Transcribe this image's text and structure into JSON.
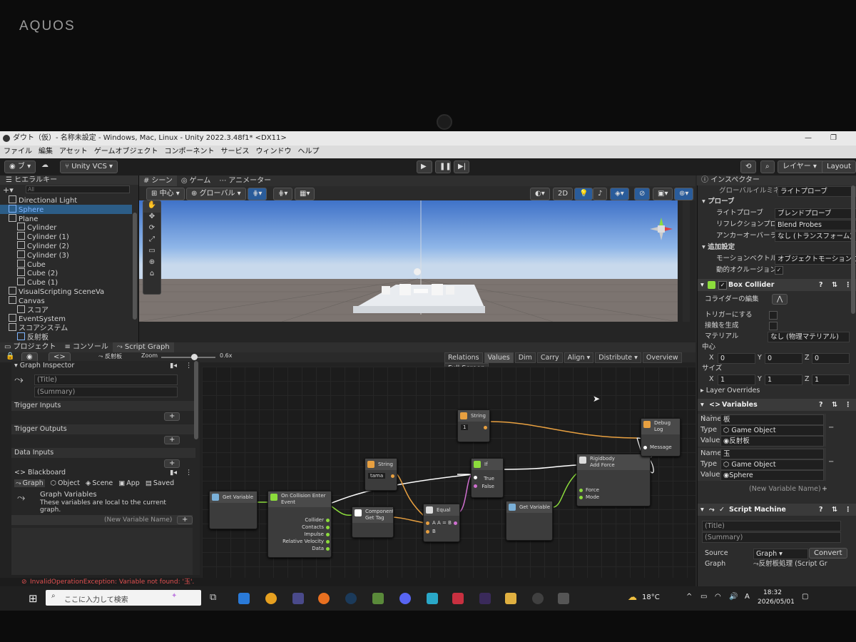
{
  "bezel_brand": "AQUOS",
  "window": {
    "title": "ダウト（仮）- 名称未設定 - Windows, Mac, Linux - Unity 2022.3.48f1* <DX11>"
  },
  "menu": [
    "ファイル",
    "編集",
    "アセット",
    "ゲームオブジェクト",
    "コンポーネント",
    "サービス",
    "ウィンドウ",
    "ヘルプ"
  ],
  "toolbar": {
    "account_label": "ブ",
    "vcs_label": "Unity VCS",
    "layers_label": "レイヤー",
    "layout_label": "Layout"
  },
  "hierarchy": {
    "tab": "ヒエラルキー",
    "search_placeholder": "All",
    "items": [
      {
        "label": "Directional Light",
        "indent": 1,
        "color": "#d2d2d2"
      },
      {
        "label": "Sphere",
        "indent": 1,
        "color": "#7fb4ff"
      },
      {
        "label": "Plane",
        "indent": 1,
        "color": "#d2d2d2"
      },
      {
        "label": "Cylinder",
        "indent": 2,
        "color": "#d2d2d2"
      },
      {
        "label": "Cylinder (1)",
        "indent": 2,
        "color": "#d2d2d2"
      },
      {
        "label": "Cylinder (2)",
        "indent": 2,
        "color": "#d2d2d2"
      },
      {
        "label": "Cylinder (3)",
        "indent": 2,
        "color": "#d2d2d2"
      },
      {
        "label": "Cube",
        "indent": 2,
        "color": "#d2d2d2"
      },
      {
        "label": "Cube (2)",
        "indent": 2,
        "color": "#d2d2d2"
      },
      {
        "label": "Cube (1)",
        "indent": 2,
        "color": "#d2d2d2"
      },
      {
        "label": "VisualScripting SceneVa",
        "indent": 1,
        "color": "#d2d2d2"
      },
      {
        "label": "Canvas",
        "indent": 1,
        "color": "#d2d2d2"
      },
      {
        "label": "スコア",
        "indent": 2,
        "color": "#d2d2d2"
      },
      {
        "label": "EventSystem",
        "indent": 1,
        "color": "#d2d2d2"
      },
      {
        "label": "スコアシステム",
        "indent": 1,
        "color": "#d2d2d2"
      },
      {
        "label": "反射板",
        "indent": 2,
        "color": "#d2d2d2"
      }
    ]
  },
  "scene_tabs": [
    "シーン",
    "ゲーム",
    "アニメーター"
  ],
  "scene_toolbar": {
    "pivot": "中心",
    "space": "グローバル",
    "mode_2d": "2D"
  },
  "bottom_tabs": [
    "プロジェクト",
    "コンソール",
    "Script Graph"
  ],
  "graph_toolbar": {
    "breadcrumb": "反射板",
    "zoom_label": "Zoom",
    "zoom_value": "0.6x",
    "zoom_level": 0.6,
    "buttons": [
      "Relations",
      "Values",
      "Dim",
      "Carry",
      "Align ▾",
      "Distribute ▾",
      "Overview",
      "Full Screen"
    ]
  },
  "graph_inspector": {
    "header": "Graph Inspector",
    "title_placeholder": "(Title)",
    "summary_placeholder": "(Summary)",
    "sections": [
      "Trigger Inputs",
      "Trigger Outputs",
      "Data Inputs"
    ],
    "blackboard_label": "Blackboard",
    "tabs": [
      "Graph",
      "Object",
      "Scene",
      "App",
      "Saved"
    ],
    "graph_vars_title": "Graph Variables",
    "graph_vars_desc_1": "These variables are local to the current",
    "graph_vars_desc_2": "graph.",
    "new_var_placeholder": "(New Variable Name)"
  },
  "nodes": {
    "get_variable_1": {
      "title": "Get Variable"
    },
    "on_collision": {
      "title": "On Collision Enter",
      "subtitle": "Event",
      "ports": [
        "Collider",
        "Contacts",
        "Impulse",
        "Relative Velocity",
        "Data"
      ]
    },
    "string_tama": {
      "title": "String",
      "value": "tama"
    },
    "component_get_tag": {
      "title": "Component",
      "subtitle": "Get Tag"
    },
    "equal": {
      "title": "Equal",
      "port_a": "A  A = B",
      "port_b": "B"
    },
    "if": {
      "title": "If",
      "port_true": "True",
      "port_false": "False"
    },
    "string_1": {
      "title": "String",
      "value": "1"
    },
    "get_variable_2": {
      "title": "Get Variable"
    },
    "rigidbody": {
      "title": "Rigidbody",
      "subtitle": "Add Force",
      "ports": [
        "Force",
        "Mode"
      ]
    },
    "debug_log": {
      "title": "Debug",
      "subtitle": "Log",
      "port": "Message"
    }
  },
  "inspector": {
    "tab": "インスペクター",
    "global_illum_label": "グローバルイルミネーション",
    "global_illum_value": "ライトプローブ",
    "probes_header": "プローブ",
    "light_probe_label": "ライトプローブ",
    "light_probe_value": "ブレンドプローブ",
    "reflection_label": "リフレクションプローブ",
    "reflection_value": "Blend Probes",
    "anchor_label": "アンカーオーバーライド",
    "anchor_value": "なし (トランスフォーム)",
    "additional_header": "追加設定",
    "motion_label": "モーションベクトル",
    "motion_value": "オブジェクトモーションごと",
    "occlusion_label": "動的オクルージョン",
    "box_collider": "Box Collider",
    "edit_collider": "コライダーの編集",
    "is_trigger": "トリガーにする",
    "provides_contacts": "接触を生成",
    "material_label": "マテリアル",
    "material_value": "なし (物理マテリアル)",
    "center_label": "中心",
    "center": {
      "x": "0",
      "y": "0",
      "z": "0"
    },
    "size_label": "サイズ",
    "size": {
      "x": "1",
      "y": "1",
      "z": "1"
    },
    "layer_overrides": "Layer Overrides",
    "variables_header": "Variables",
    "var1": {
      "name_label": "Name",
      "name": "板",
      "type_label": "Type",
      "type": "Game Object",
      "value_label": "Value",
      "value": "反射板"
    },
    "var2": {
      "name_label": "Name",
      "name": "玉",
      "type_label": "Type",
      "type": "Game Object",
      "value_label": "Value",
      "value": "Sphere"
    },
    "new_variable": "(New Variable Name)",
    "script_machine": "Script Machine",
    "sm_title": "(Title)",
    "sm_summary": "(Summary)",
    "source_label": "Source",
    "source_value": "Graph",
    "convert_label": "Convert",
    "graph_label": "Graph",
    "graph_value": "反射板処理 (Script Gr"
  },
  "status": {
    "error": "InvalidOperationException: Variable not found: '玉'."
  },
  "taskbar": {
    "search_placeholder": "ここに入力して検索",
    "temperature": "18°C",
    "time": "18:32",
    "date": "2026/05/01",
    "lang": "A"
  },
  "colors": {
    "accent": "#4a90d9",
    "unity_bg": "#282828",
    "flow_orange": "#e8a040",
    "flow_white": "#ffffff",
    "flow_green": "#8cdc3c",
    "flow_pink": "#d070d0",
    "error": "#e05050"
  }
}
